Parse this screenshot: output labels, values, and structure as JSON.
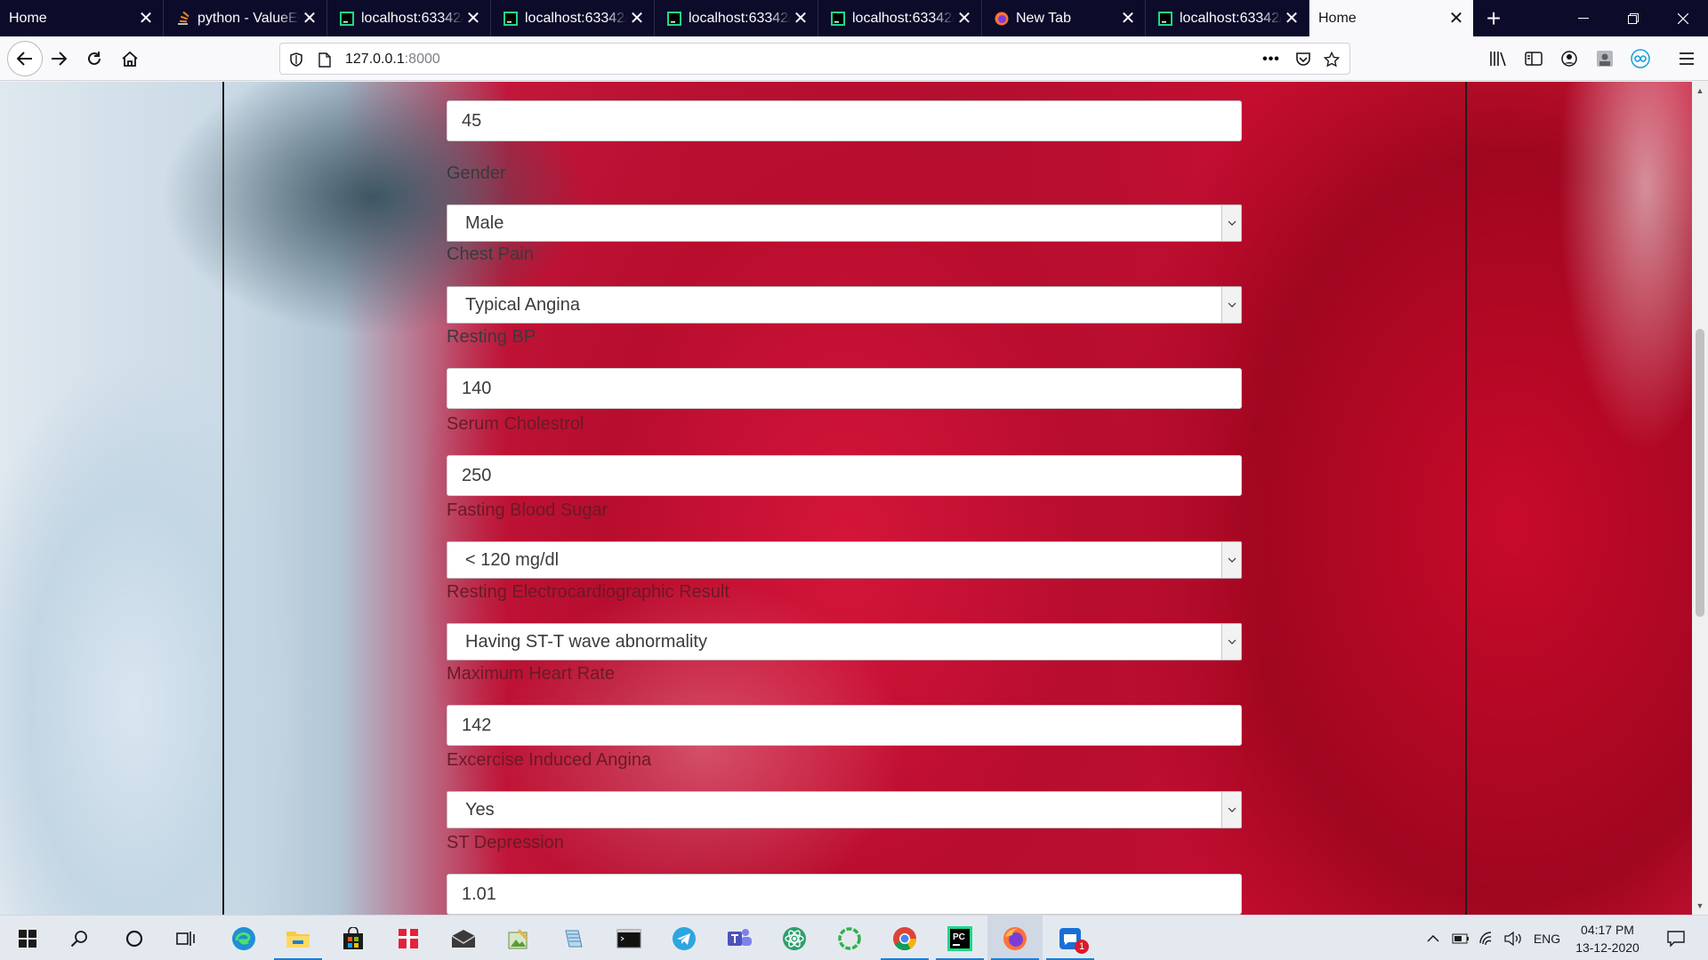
{
  "browser": {
    "tabs": [
      {
        "title": "Home",
        "icon": "home-favicon",
        "active": false
      },
      {
        "title": "python - ValueEr",
        "icon": "stackoverflow-icon",
        "active": false
      },
      {
        "title": "localhost:63342/",
        "icon": "pycharm-icon",
        "active": false
      },
      {
        "title": "localhost:63342/",
        "icon": "pycharm-icon",
        "active": false
      },
      {
        "title": "localhost:63342/",
        "icon": "pycharm-icon",
        "active": false
      },
      {
        "title": "localhost:63342/",
        "icon": "pycharm-icon",
        "active": false
      },
      {
        "title": "New Tab",
        "icon": "firefox-icon",
        "active": false
      },
      {
        "title": "localhost:63342/",
        "icon": "pycharm-icon",
        "active": false
      },
      {
        "title": "Home",
        "icon": "none",
        "active": true
      }
    ],
    "url_host": "127.0.0.1",
    "url_port": ":8000"
  },
  "form": {
    "age_value": "45",
    "gender_label": "Gender",
    "gender_value": "Male",
    "chest_pain_label": "Chest Pain",
    "chest_pain_value": "Typical Angina",
    "resting_bp_label": "Resting BP",
    "resting_bp_value": "140",
    "cholesterol_label": "Serum Cholestrol",
    "cholesterol_value": "250",
    "fbs_label": "Fasting Blood Sugar",
    "fbs_value": "< 120 mg/dl",
    "ecg_label": "Resting Electrocardiographic Result",
    "ecg_value": "Having ST-T wave abnormality",
    "max_hr_label": "Maximum Heart Rate",
    "max_hr_value": "142",
    "exang_label": "Excercise Induced Angina",
    "exang_value": "Yes",
    "st_dep_label": "ST Depression",
    "st_dep_value": "1.01"
  },
  "taskbar": {
    "language": "ENG",
    "time": "04:17 PM",
    "date": "13-12-2020",
    "notification_count": "1"
  },
  "colors": {
    "accent": "#1a7fd6",
    "tab_bar": "#0c0c2a",
    "pycharm_green": "#21d789"
  }
}
